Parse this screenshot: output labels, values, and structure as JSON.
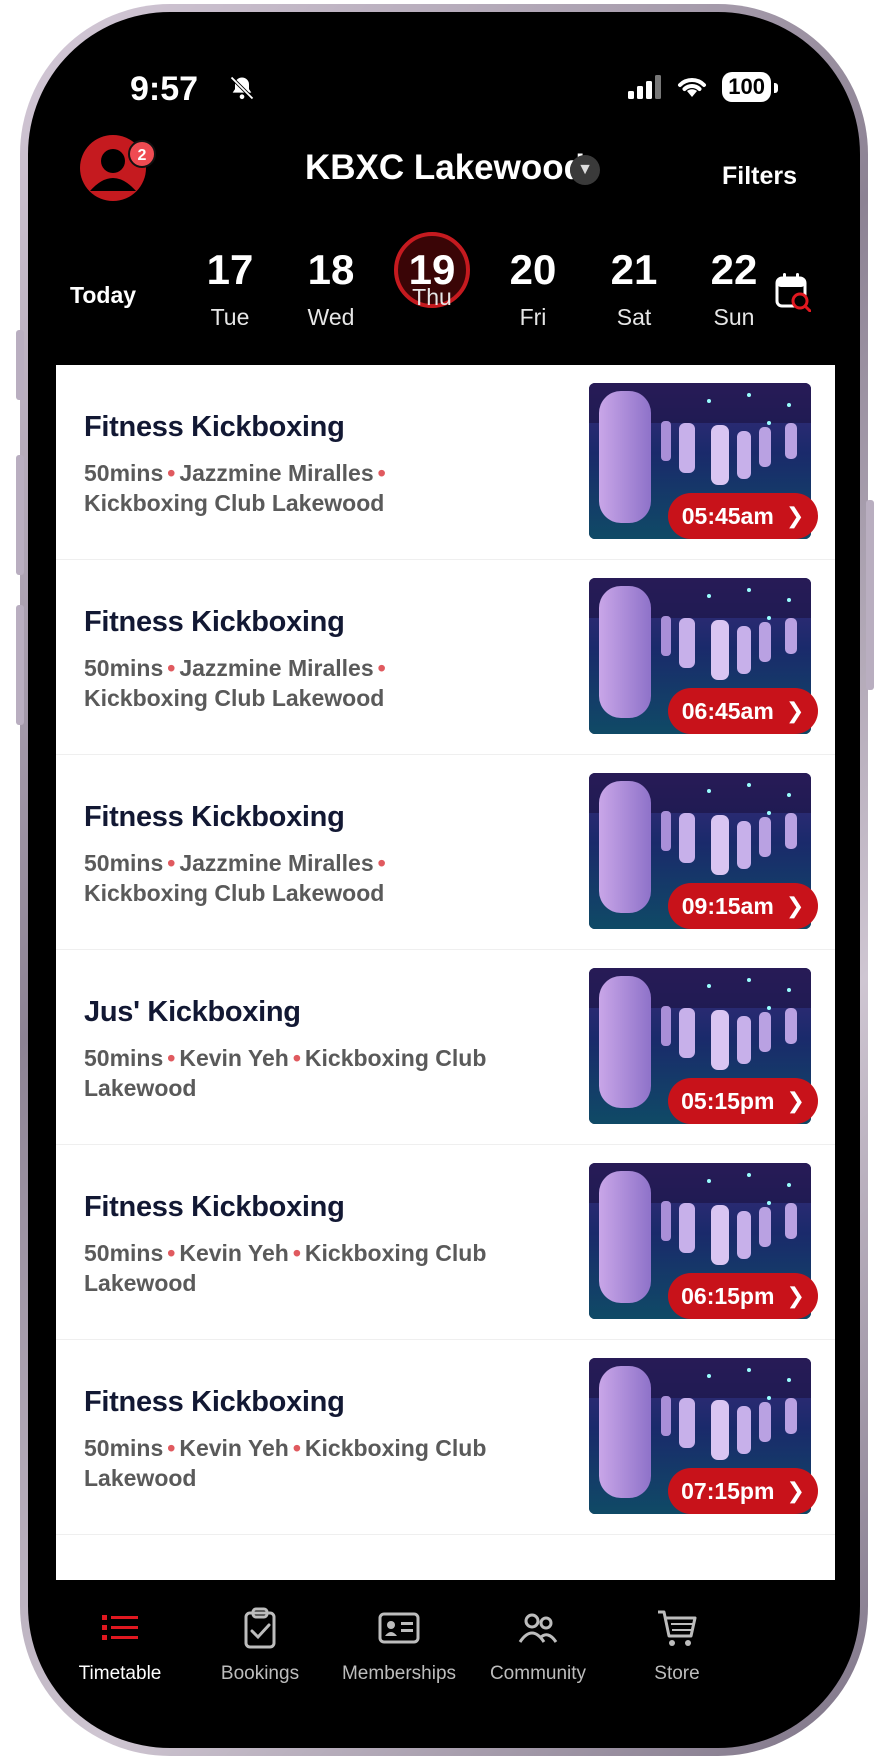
{
  "status_bar": {
    "time": "9:57",
    "battery": "100"
  },
  "header": {
    "location": "KBXC Lakewood",
    "filters_label": "Filters",
    "notification_count": "2"
  },
  "dates": {
    "today_label": "Today",
    "days": [
      {
        "num": "17",
        "dow": "Tue"
      },
      {
        "num": "18",
        "dow": "Wed"
      },
      {
        "num": "19",
        "dow": "Thu",
        "selected": true
      },
      {
        "num": "20",
        "dow": "Fri"
      },
      {
        "num": "21",
        "dow": "Sat"
      },
      {
        "num": "22",
        "dow": "Sun"
      }
    ]
  },
  "classes": [
    {
      "title": "Fitness Kickboxing",
      "duration": "50mins",
      "instructor": "Jazzmine Miralles",
      "location": "Kickboxing Club Lakewood",
      "time": "05:45am"
    },
    {
      "title": "Fitness Kickboxing",
      "duration": "50mins",
      "instructor": "Jazzmine Miralles",
      "location": "Kickboxing Club Lakewood",
      "time": "06:45am"
    },
    {
      "title": "Fitness Kickboxing",
      "duration": "50mins",
      "instructor": "Jazzmine Miralles",
      "location": "Kickboxing Club Lakewood",
      "time": "09:15am"
    },
    {
      "title": "Jus' Kickboxing",
      "duration": "50mins",
      "instructor": "Kevin Yeh",
      "location": "Kickboxing Club Lakewood",
      "time": "05:15pm"
    },
    {
      "title": "Fitness Kickboxing",
      "duration": "50mins",
      "instructor": "Kevin Yeh",
      "location": "Kickboxing Club Lakewood",
      "time": "06:15pm"
    },
    {
      "title": "Fitness Kickboxing",
      "duration": "50mins",
      "instructor": "Kevin Yeh",
      "location": "Kickboxing Club Lakewood",
      "time": "07:15pm"
    }
  ],
  "nav": [
    {
      "label": "Timetable",
      "icon": "list-icon",
      "active": true
    },
    {
      "label": "Bookings",
      "icon": "clipboard-check-icon"
    },
    {
      "label": "Memberships",
      "icon": "membership-card-icon"
    },
    {
      "label": "Community",
      "icon": "people-icon"
    },
    {
      "label": "Store",
      "icon": "cart-icon"
    }
  ],
  "colors": {
    "accent": "#c8121a",
    "text_title": "#121833",
    "text_meta": "#5a5a5a"
  }
}
